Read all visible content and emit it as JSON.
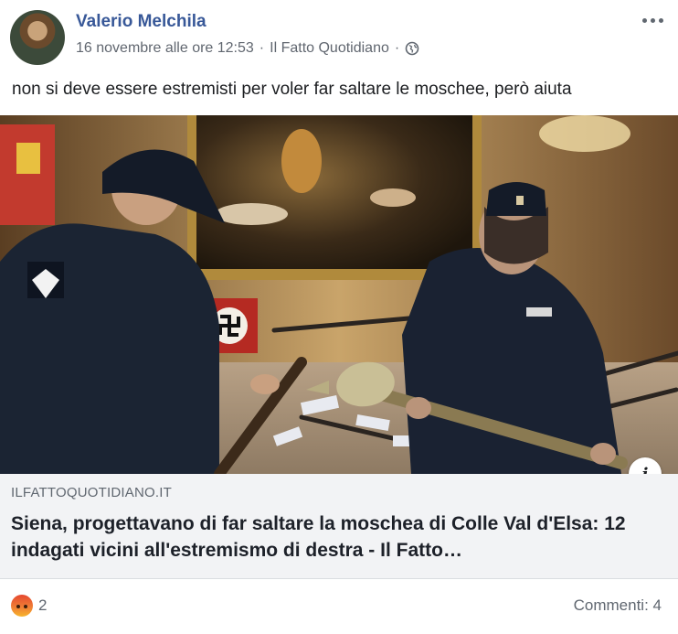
{
  "post": {
    "author": "Valerio Melchila",
    "date": "16 novembre alle ore 12:53",
    "separator": "·",
    "via": "Il Fatto Quotidiano",
    "separator2": "·",
    "privacy_icon": "globe-icon",
    "more_icon": "more-options-icon",
    "status_text": "non si deve essere estremisti per voler far saltare le moschee, però aiuta"
  },
  "link": {
    "domain": "ILFATTOQUOTIDIANO.IT",
    "headline": "Siena, progettavano di far saltare la moschea di Colle Val d'Elsa: 12 indagati vicini all'estremismo di destra - Il Fatto…",
    "info_label": "i"
  },
  "footer": {
    "reaction_icon": "angry-reaction-icon",
    "reaction_count": "2",
    "comments": "Commenti: 4"
  },
  "colors": {
    "author": "#385898",
    "caption_bg": "#f2f3f5",
    "meta": "#616770"
  }
}
